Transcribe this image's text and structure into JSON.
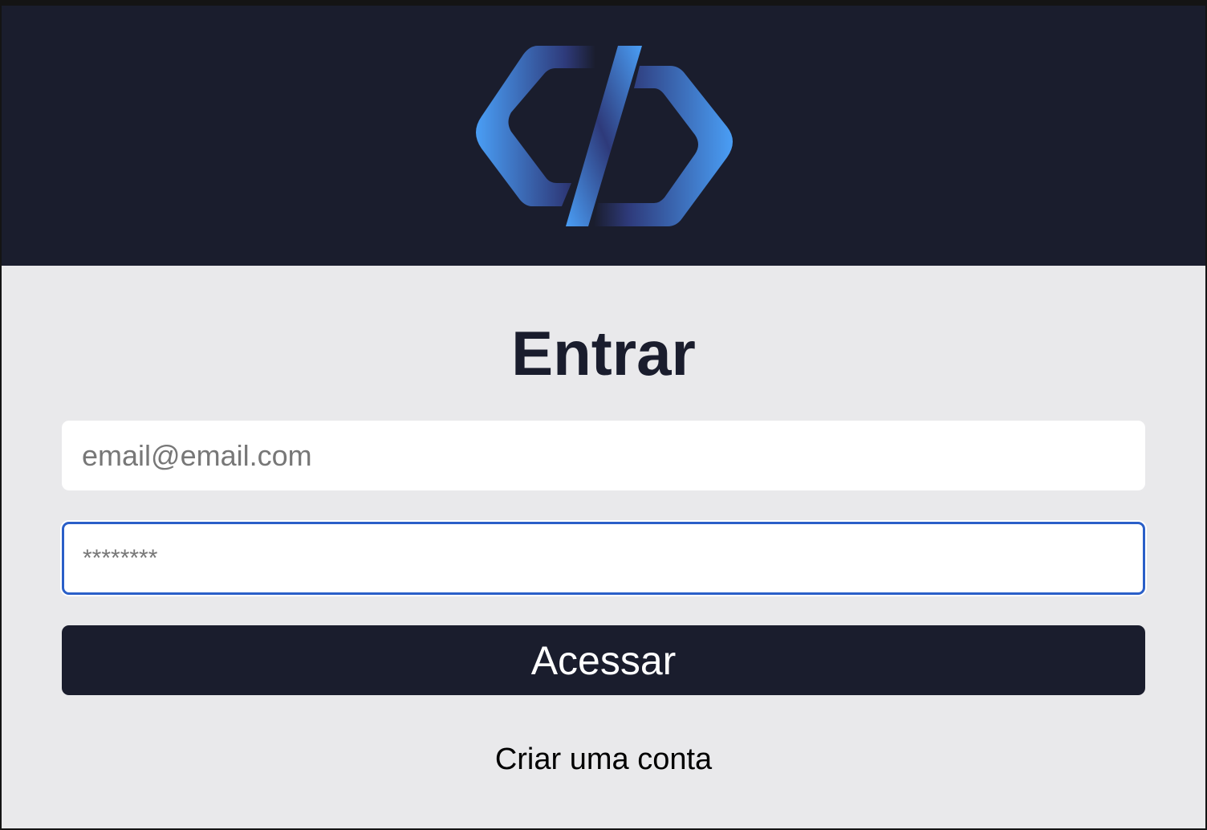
{
  "header": {
    "logo": "code-brackets-logo"
  },
  "login": {
    "title": "Entrar",
    "email_placeholder": "email@email.com",
    "email_value": "",
    "password_placeholder": "********",
    "password_value": "",
    "submit_label": "Acessar",
    "create_account_label": "Criar uma conta"
  },
  "colors": {
    "header_bg": "#1a1d2d",
    "accent": "#4a9ef5",
    "focus": "#2a5fc8",
    "page_bg": "#e9e9eb"
  }
}
